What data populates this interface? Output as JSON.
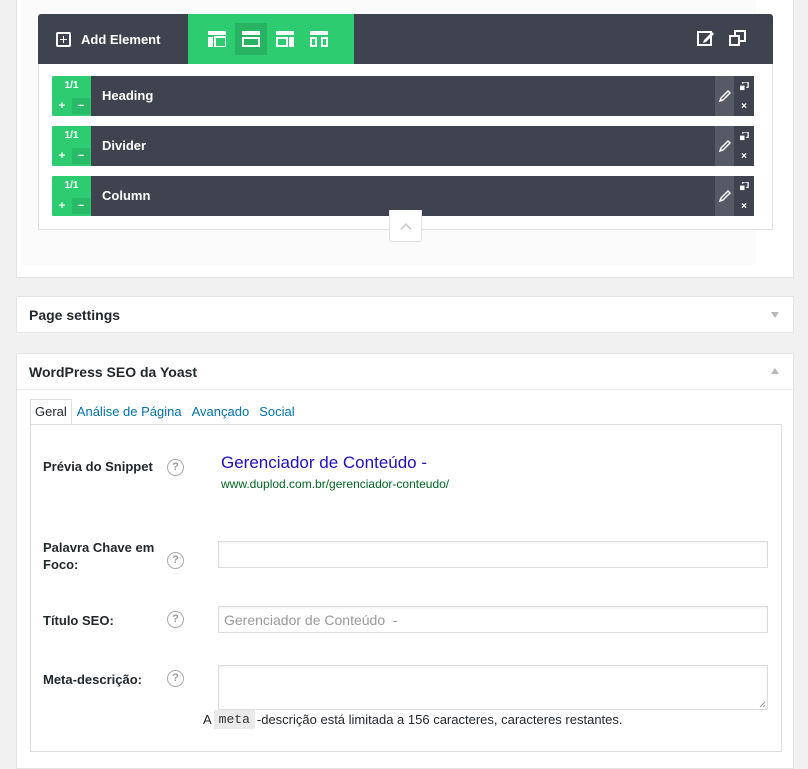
{
  "builder": {
    "add_element_label": "Add Element",
    "layouts": [
      "layout-one-third-icon",
      "layout-full-icon",
      "layout-two-thirds-icon",
      "layout-columns-icon"
    ],
    "elements": [
      {
        "size": "1/1",
        "name": "Heading"
      },
      {
        "size": "1/1",
        "name": "Divider"
      },
      {
        "size": "1/1",
        "name": "Column"
      }
    ],
    "plus": "+",
    "minus": "−",
    "remove": "×"
  },
  "page_settings": {
    "title": "Page settings"
  },
  "seo": {
    "title": "WordPress SEO da Yoast",
    "tabs": [
      "Geral",
      "Análise de Página",
      "Avançado",
      "Social"
    ],
    "active_tab": "Geral",
    "snippet_label": "Prévia do Snippet",
    "snippet_title": "Gerenciador de Conteúdo -",
    "snippet_url": "www.duplod.com.br/gerenciador-conteudo/",
    "focus_kw_label_line1": "Palavra Chave em",
    "focus_kw_label_line2": "Foco:",
    "focus_kw_value": "",
    "seo_title_label": "Título SEO:",
    "seo_title_placeholder": "Gerenciador de Conteúdo  -",
    "meta_label": "Meta-descrição:",
    "meta_value": "",
    "meta_note_prefix": "A",
    "meta_note_code": "meta",
    "meta_note_suffix": "-descrição está limitada a 156 caracteres, caracteres restantes.",
    "help_symbol": "?"
  },
  "colors": {
    "accent_green": "#2ecc71",
    "toolbar_dark": "#3f434f",
    "link_blue": "#0073aa",
    "snippet_blue": "#1e0fbe",
    "snippet_green": "#006621"
  }
}
